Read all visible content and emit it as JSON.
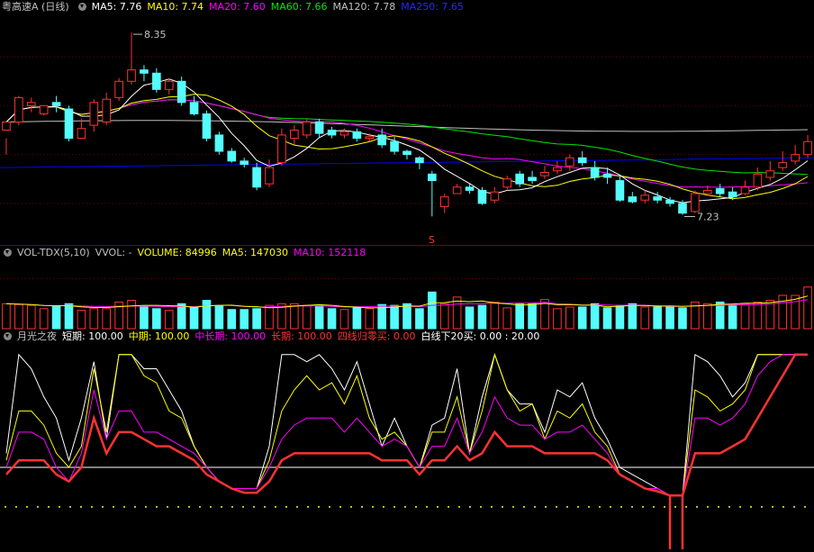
{
  "price_header": {
    "title": "粤高速A (日线)",
    "ma5": "MA5: 7.76",
    "ma10": "MA10: 7.74",
    "ma20": "MA20: 7.60",
    "ma60": "MA60: 7.66",
    "ma120": "MA120: 7.78",
    "ma250": "MA250: 7.65"
  },
  "price_labels": {
    "high": "8.35",
    "low": "7.23",
    "signal": "S"
  },
  "vol_header": {
    "title": "VOL-TDX(5,10)",
    "vvol": "VVOL: -",
    "volume": "VOLUME: 84996",
    "ma5": "MA5: 147030",
    "ma10": "MA10: 152118"
  },
  "ind_header": {
    "title": "月光之夜",
    "short": "短期: 100.00",
    "mid": "中期: 100.00",
    "midlong": "中长期: 100.00",
    "long": "长期: 100.00",
    "zero": "四线归零买: 0.00",
    "white": "白线下20买: 0.00 : 20.00"
  },
  "colors": {
    "up": "#ff3232",
    "down": "#54fcfc",
    "ma5": "#ffffff",
    "ma10": "#ffff00",
    "ma20": "#ff00ff",
    "ma60": "#00e600",
    "ma120": "#c0c0c0",
    "ma250": "#0000ff"
  },
  "chart_data": [
    {
      "type": "candlestick",
      "title": "粤高速A (日线)",
      "ylim": [
        7.1,
        8.45
      ],
      "annotations": [
        {
          "label": "8.35",
          "value": 8.35
        },
        {
          "label": "7.23",
          "value": 7.23
        }
      ],
      "candles": [
        [
          7.75,
          7.8,
          7.7,
          7.6
        ],
        [
          7.8,
          7.95,
          7.96,
          7.78
        ],
        [
          7.9,
          7.92,
          7.95,
          7.86
        ],
        [
          7.85,
          7.9,
          7.88,
          7.84
        ],
        [
          7.92,
          7.9,
          7.96,
          7.86
        ],
        [
          7.88,
          7.7,
          7.9,
          7.68
        ],
        [
          7.7,
          7.76,
          7.82,
          7.7
        ],
        [
          7.78,
          7.92,
          7.94,
          7.74
        ],
        [
          7.8,
          7.94,
          7.98,
          7.78
        ],
        [
          7.95,
          8.05,
          8.07,
          7.93
        ],
        [
          8.05,
          8.12,
          8.35,
          8.03
        ],
        [
          8.12,
          8.1,
          8.15,
          8.05
        ],
        [
          8.1,
          8.0,
          8.13,
          7.98
        ],
        [
          8.0,
          8.05,
          8.07,
          7.97
        ],
        [
          8.05,
          7.92,
          8.08,
          7.9
        ],
        [
          7.92,
          7.85,
          7.96,
          7.84
        ],
        [
          7.85,
          7.7,
          7.87,
          7.68
        ],
        [
          7.72,
          7.62,
          7.74,
          7.6
        ],
        [
          7.62,
          7.56,
          7.64,
          7.55
        ],
        [
          7.56,
          7.54,
          7.58,
          7.52
        ],
        [
          7.52,
          7.4,
          7.55,
          7.38
        ],
        [
          7.42,
          7.52,
          7.57,
          7.4
        ],
        [
          7.55,
          7.72,
          7.76,
          7.53
        ],
        [
          7.7,
          7.75,
          7.78,
          7.66
        ],
        [
          7.72,
          7.8,
          7.82,
          7.7
        ],
        [
          7.8,
          7.73,
          7.82,
          7.7
        ],
        [
          7.75,
          7.72,
          7.77,
          7.7
        ],
        [
          7.72,
          7.74,
          7.76,
          7.7
        ],
        [
          7.74,
          7.7,
          7.76,
          7.68
        ],
        [
          7.7,
          7.71,
          7.73,
          7.68
        ],
        [
          7.72,
          7.66,
          7.76,
          7.64
        ],
        [
          7.68,
          7.62,
          7.71,
          7.6
        ],
        [
          7.62,
          7.6,
          7.63,
          7.57
        ],
        [
          7.58,
          7.55,
          7.59,
          7.51
        ],
        [
          7.48,
          7.44,
          7.5,
          7.22
        ],
        [
          7.28,
          7.34,
          7.36,
          7.24
        ],
        [
          7.36,
          7.4,
          7.42,
          7.36
        ],
        [
          7.4,
          7.38,
          7.42,
          7.36
        ],
        [
          7.38,
          7.3,
          7.4,
          7.29
        ],
        [
          7.32,
          7.37,
          7.4,
          7.3
        ],
        [
          7.4,
          7.45,
          7.47,
          7.38
        ],
        [
          7.48,
          7.42,
          7.5,
          7.4
        ],
        [
          7.46,
          7.44,
          7.5,
          7.42
        ],
        [
          7.47,
          7.49,
          7.53,
          7.45
        ],
        [
          7.5,
          7.52,
          7.56,
          7.48
        ],
        [
          7.53,
          7.58,
          7.6,
          7.5
        ],
        [
          7.58,
          7.55,
          7.62,
          7.53
        ],
        [
          7.52,
          7.46,
          7.56,
          7.44
        ],
        [
          7.48,
          7.46,
          7.52,
          7.42
        ],
        [
          7.44,
          7.32,
          7.47,
          7.31
        ],
        [
          7.34,
          7.31,
          7.37,
          7.3
        ],
        [
          7.32,
          7.35,
          7.38,
          7.3
        ],
        [
          7.34,
          7.32,
          7.37,
          7.3
        ],
        [
          7.32,
          7.3,
          7.34,
          7.28
        ],
        [
          7.3,
          7.24,
          7.32,
          7.23
        ],
        [
          7.25,
          7.36,
          7.38,
          7.24
        ],
        [
          7.36,
          7.38,
          7.41,
          7.35
        ],
        [
          7.39,
          7.36,
          7.42,
          7.34
        ],
        [
          7.37,
          7.34,
          7.4,
          7.32
        ],
        [
          7.36,
          7.4,
          7.44,
          7.35
        ],
        [
          7.4,
          7.48,
          7.52,
          7.38
        ],
        [
          7.46,
          7.5,
          7.56,
          7.44
        ],
        [
          7.52,
          7.55,
          7.62,
          7.5
        ],
        [
          7.56,
          7.6,
          7.66,
          7.54
        ],
        [
          7.6,
          7.68,
          7.72,
          7.58
        ]
      ]
    },
    {
      "type": "bar",
      "title": "VOL-TDX(5,10)",
      "ylim": [
        0,
        400000
      ],
      "values": [
        150000,
        145000,
        140000,
        120000,
        135000,
        150000,
        110000,
        120000,
        120000,
        160000,
        170000,
        130000,
        120000,
        110000,
        150000,
        130000,
        170000,
        140000,
        115000,
        115000,
        120000,
        140000,
        150000,
        150000,
        140000,
        140000,
        120000,
        115000,
        130000,
        120000,
        145000,
        140000,
        150000,
        120000,
        220000,
        150000,
        190000,
        130000,
        140000,
        160000,
        125000,
        150000,
        150000,
        175000,
        120000,
        130000,
        130000,
        150000,
        125000,
        140000,
        150000,
        130000,
        130000,
        135000,
        125000,
        160000,
        150000,
        160000,
        145000,
        150000,
        160000,
        170000,
        200000,
        200000,
        250000
      ]
    },
    {
      "type": "line",
      "title": "月光之夜",
      "ylim": [
        -10,
        105
      ],
      "series": [
        {
          "name": "短期",
          "values": [
            30,
            100,
            90,
            70,
            55,
            25,
            55,
            95,
            40,
            100,
            100,
            90,
            90,
            75,
            60,
            35,
            20,
            10,
            5,
            5,
            5,
            35,
            100,
            100,
            95,
            100,
            90,
            75,
            95,
            65,
            35,
            55,
            35,
            20,
            50,
            55,
            90,
            30,
            70,
            100,
            75,
            65,
            65,
            45,
            75,
            70,
            80,
            55,
            40,
            20,
            15,
            10,
            5,
            0,
            0,
            100,
            95,
            85,
            70,
            80,
            100,
            100,
            100,
            100,
            100
          ]
        },
        {
          "name": "中期",
          "values": [
            25,
            60,
            60,
            50,
            30,
            20,
            35,
            90,
            45,
            100,
            100,
            85,
            80,
            60,
            55,
            35,
            20,
            10,
            5,
            5,
            5,
            25,
            60,
            75,
            85,
            75,
            80,
            65,
            85,
            55,
            40,
            45,
            35,
            20,
            45,
            45,
            70,
            30,
            60,
            100,
            75,
            60,
            65,
            40,
            60,
            55,
            65,
            45,
            35,
            15,
            10,
            5,
            5,
            0,
            0,
            75,
            70,
            60,
            65,
            75,
            100,
            100,
            100,
            100,
            100
          ]
        },
        {
          "name": "中长期",
          "values": [
            20,
            45,
            45,
            40,
            20,
            10,
            30,
            75,
            40,
            60,
            60,
            45,
            45,
            40,
            35,
            30,
            20,
            10,
            5,
            5,
            5,
            20,
            40,
            50,
            55,
            55,
            55,
            45,
            55,
            45,
            35,
            40,
            35,
            20,
            35,
            35,
            55,
            30,
            45,
            70,
            55,
            50,
            50,
            40,
            45,
            45,
            50,
            40,
            30,
            15,
            10,
            5,
            5,
            0,
            0,
            55,
            55,
            50,
            55,
            65,
            85,
            95,
            100,
            100,
            100
          ]
        },
        {
          "name": "长期",
          "values": [
            15,
            25,
            25,
            25,
            15,
            10,
            20,
            55,
            30,
            45,
            45,
            40,
            35,
            35,
            30,
            25,
            15,
            10,
            5,
            2,
            2,
            10,
            25,
            30,
            30,
            30,
            30,
            30,
            30,
            30,
            25,
            25,
            25,
            15,
            25,
            25,
            35,
            25,
            30,
            45,
            35,
            35,
            35,
            30,
            30,
            30,
            30,
            30,
            25,
            15,
            10,
            5,
            3,
            0,
            0,
            30,
            30,
            30,
            35,
            40,
            55,
            70,
            85,
            100,
            100
          ]
        }
      ]
    }
  ]
}
